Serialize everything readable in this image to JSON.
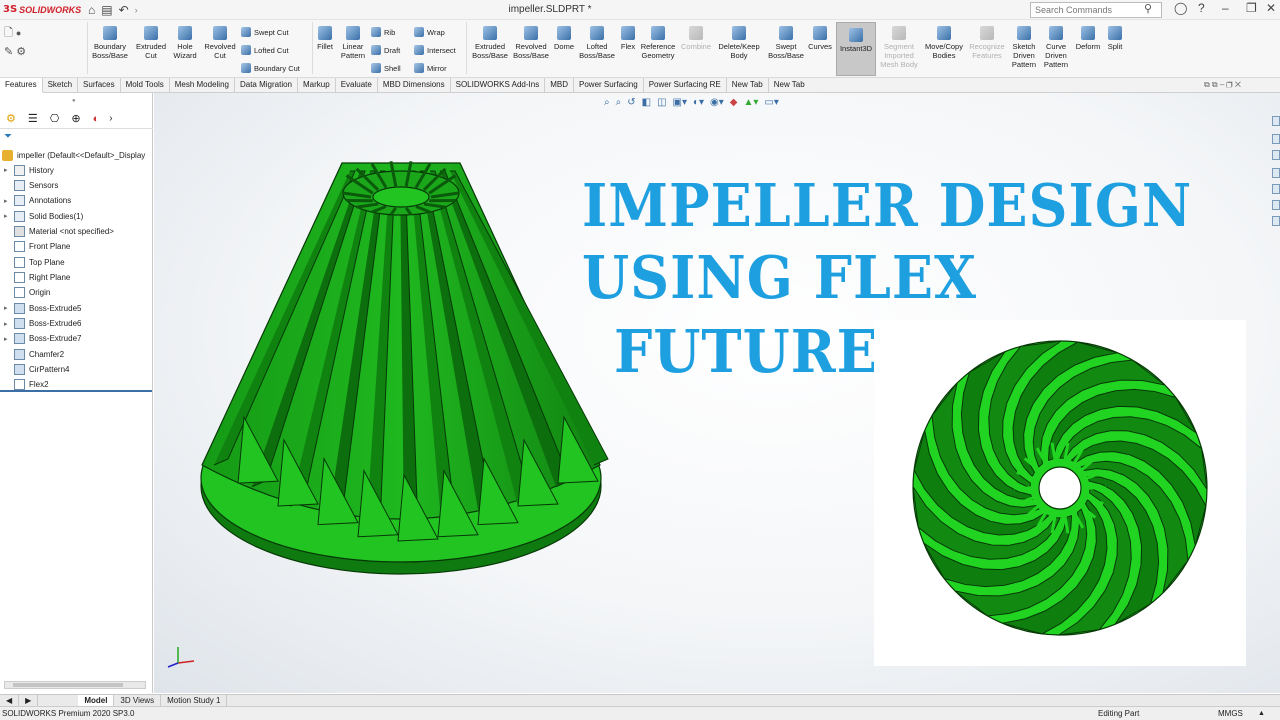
{
  "app": {
    "brand_ds": "3S",
    "brand_name": "SOLIDWORKS",
    "doc_title": "impeller.SLDPRT *"
  },
  "search": {
    "placeholder": "Search Commands"
  },
  "ribbon": {
    "big": [
      {
        "label": "Boundary\nBoss/Base",
        "icon": "boundary-boss-icon"
      },
      {
        "label": "Extruded\nCut",
        "icon": "extruded-cut-icon"
      },
      {
        "label": "Hole\nWizard",
        "icon": "hole-wizard-icon"
      },
      {
        "label": "Revolved\nCut",
        "icon": "revolved-cut-icon"
      },
      {
        "label": "Fillet",
        "icon": "fillet-icon"
      },
      {
        "label": "Linear\nPattern",
        "icon": "linear-pattern-icon"
      },
      {
        "label": "Extruded\nBoss/Base",
        "icon": "extruded-boss-icon"
      },
      {
        "label": "Revolved\nBoss/Base",
        "icon": "revolved-boss-icon"
      },
      {
        "label": "Dome",
        "icon": "dome-icon"
      },
      {
        "label": "Lofted\nBoss/Base",
        "icon": "lofted-boss-icon"
      },
      {
        "label": "Flex",
        "icon": "flex-icon"
      },
      {
        "label": "Reference\nGeometry",
        "icon": "reference-geometry-icon"
      },
      {
        "label": "Combine",
        "icon": "combine-icon"
      },
      {
        "label": "Delete/Keep\nBody",
        "icon": "delete-keep-body-icon"
      },
      {
        "label": "Swept\nBoss/Base",
        "icon": "swept-boss-icon"
      },
      {
        "label": "Curves",
        "icon": "curves-icon"
      },
      {
        "label": "Instant3D",
        "icon": "instant3d-icon"
      },
      {
        "label": "Segment\nImported\nMesh Body",
        "icon": "segment-mesh-icon"
      },
      {
        "label": "Move/Copy\nBodies",
        "icon": "move-copy-icon"
      },
      {
        "label": "Recognize\nFeatures",
        "icon": "recognize-features-icon"
      },
      {
        "label": "Sketch\nDriven\nPattern",
        "icon": "sketch-driven-pattern-icon"
      },
      {
        "label": "Curve\nDriven\nPattern",
        "icon": "curve-driven-pattern-icon"
      },
      {
        "label": "Deform",
        "icon": "deform-icon"
      },
      {
        "label": "Split",
        "icon": "split-icon"
      }
    ],
    "small": [
      {
        "label": "Swept Cut",
        "icon": "swept-cut-icon"
      },
      {
        "label": "Lofted Cut",
        "icon": "lofted-cut-icon"
      },
      {
        "label": "Boundary Cut",
        "icon": "boundary-cut-icon"
      },
      {
        "label": "Rib",
        "icon": "rib-icon"
      },
      {
        "label": "Draft",
        "icon": "draft-icon"
      },
      {
        "label": "Shell",
        "icon": "shell-icon"
      },
      {
        "label": "Wrap",
        "icon": "wrap-icon"
      },
      {
        "label": "Intersect",
        "icon": "intersect-icon"
      },
      {
        "label": "Mirror",
        "icon": "mirror-icon"
      }
    ]
  },
  "tabs": [
    "Features",
    "Sketch",
    "Surfaces",
    "Mold Tools",
    "Mesh Modeling",
    "Data Migration",
    "Markup",
    "Evaluate",
    "MBD Dimensions",
    "SOLIDWORKS Add-Ins",
    "MBD",
    "Power Surfacing",
    "Power Surfacing RE",
    "New Tab",
    "New Tab"
  ],
  "tree": {
    "root": "impeller  (Default<<Default>_Display",
    "items": [
      {
        "label": "History",
        "expandable": true
      },
      {
        "label": "Sensors",
        "expandable": false
      },
      {
        "label": "Annotations",
        "expandable": true
      },
      {
        "label": "Solid Bodies(1)",
        "expandable": true
      },
      {
        "label": "Material <not specified>",
        "expandable": false
      },
      {
        "label": "Front Plane",
        "expandable": false
      },
      {
        "label": "Top Plane",
        "expandable": false
      },
      {
        "label": "Right Plane",
        "expandable": false
      },
      {
        "label": "Origin",
        "expandable": false
      },
      {
        "label": "Boss-Extrude5",
        "expandable": true
      },
      {
        "label": "Boss-Extrude6",
        "expandable": true
      },
      {
        "label": "Boss-Extrude7",
        "expandable": true
      },
      {
        "label": "Chamfer2",
        "expandable": false
      },
      {
        "label": "CirPattern4",
        "expandable": false
      },
      {
        "label": "Flex2",
        "expandable": false
      }
    ]
  },
  "overlay": {
    "line1": "IMPELLER DESIGN",
    "line2": "USING FLEX",
    "line3": "FUTURE"
  },
  "bottom_tabs": [
    "Model",
    "3D Views",
    "Motion Study 1"
  ],
  "status": {
    "product": "SOLIDWORKS Premium 2020 SP3.0",
    "mode": "Editing Part",
    "units": "MMGS"
  },
  "colors": {
    "model_green": "#1fb81f",
    "model_dark": "#0d6f0d",
    "title_blue": "#1e9fe0"
  }
}
